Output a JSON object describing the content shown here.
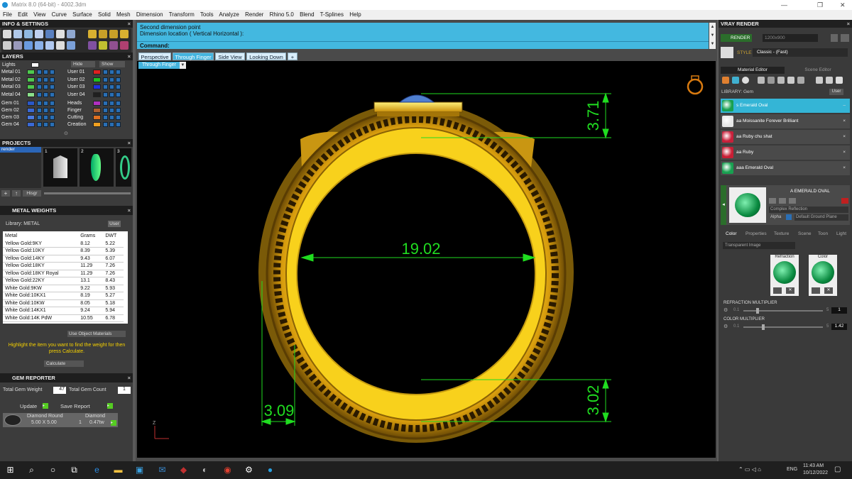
{
  "window": {
    "title": "Matrix 8.0 (64-bit) - 4002.3dm"
  },
  "menu": [
    "File",
    "Edit",
    "View",
    "Curve",
    "Surface",
    "Solid",
    "Mesh",
    "Dimension",
    "Transform",
    "Tools",
    "Analyze",
    "Render",
    "Rhino 5.0",
    "Blend",
    "T-Splines",
    "Help"
  ],
  "info_settings": {
    "title": "INFO & SETTINGS"
  },
  "layers": {
    "title": "LAYERS",
    "lights": "Lights",
    "hide": "Hide",
    "show": "Show",
    "left_items": [
      {
        "label": "Metal 01",
        "color": "#4ec94e"
      },
      {
        "label": "Metal 02",
        "color": "#4ec94e"
      },
      {
        "label": "Metal 03",
        "color": "#4ec94e"
      },
      {
        "label": "Metal 04",
        "color": "#8be08b"
      },
      {
        "label": "Gem 01",
        "color": "#2a58c8"
      },
      {
        "label": "Gem 02",
        "color": "#3a6ad6"
      },
      {
        "label": "Gem 03",
        "color": "#4a7ae0"
      },
      {
        "label": "Gem 04",
        "color": "#3a6ad6"
      }
    ],
    "right_items": [
      {
        "label": "User 01",
        "color": "#e02020"
      },
      {
        "label": "User 02",
        "color": "#20c020"
      },
      {
        "label": "User 03",
        "color": "#2030e0"
      },
      {
        "label": "User 04",
        "color": "#202020"
      },
      {
        "label": "Heads",
        "color": "#b030c0"
      },
      {
        "label": "Finger",
        "color": "#b06030"
      },
      {
        "label": "Cutting",
        "color": "#e07020"
      },
      {
        "label": "Creation",
        "color": "#f0a020"
      }
    ]
  },
  "projects": {
    "title": "PROJECTS",
    "item": "render",
    "thumbs": [
      "1",
      "2",
      "3"
    ],
    "hisgr": "Hisgr"
  },
  "metal_weights": {
    "title": "METAL WEIGHTS",
    "library_label": "Library: METAL",
    "user": "User",
    "columns": [
      "Metal",
      "Grams",
      "DWT"
    ],
    "rows": [
      [
        "Yellow Gold:9KY",
        "8.12",
        "5.22"
      ],
      [
        "Yellow Gold:10KY",
        "8.39",
        "5.39"
      ],
      [
        "Yellow Gold:14KY",
        "9.43",
        "6.07"
      ],
      [
        "Yellow Gold:18KY",
        "11.29",
        "7.26"
      ],
      [
        "Yellow Gold:18KY Royal",
        "11.29",
        "7.26"
      ],
      [
        "Yellow Gold:22KY",
        "13.1",
        "8.43"
      ],
      [
        "White Gold:9KW",
        "9.22",
        "5.93"
      ],
      [
        "White Gold:10KX1",
        "8.19",
        "5.27"
      ],
      [
        "White Gold:10KW",
        "8.05",
        "5.18"
      ],
      [
        "White Gold:14KX1",
        "9.24",
        "5.94"
      ],
      [
        "White Gold:14K PdW",
        "10.55",
        "6.78"
      ]
    ],
    "use_object_materials": "Use Object Materials",
    "hint": "Highlight the item you want to find the weight for then press Calculate.",
    "calculate": "Calculate"
  },
  "gem_reporter": {
    "title": "GEM REPORTER",
    "total_gem_weight_label": "Total Gem Weight",
    "total_gem_weight": "47",
    "total_gem_count_label": "Total Gem Count",
    "total_gem_count": "1",
    "update": "Update",
    "save_report": "Save Report",
    "gem_type": "Diamond Round",
    "gem_size": "5.00 X 5.00",
    "gem_material": "Diamond",
    "gem_qty": "1",
    "gem_weight": "0.47tw"
  },
  "command": {
    "line1": "Second dimension point",
    "line2": "Dimension location ( Vertical  Horizontal ):",
    "prompt": "Command:"
  },
  "viewport_tabs": [
    "Perspective",
    "Through Finger",
    "Side View",
    "Looking Down",
    "+"
  ],
  "active_view_label": "Through Finger",
  "dimensions": {
    "top": "3.71",
    "width": "19.02",
    "right_bottom": "3.02",
    "left_bottom": "3.09"
  },
  "vray": {
    "title": "VRAY RENDER",
    "render_btn": "RENDER",
    "resolution": "1200x900",
    "style_label": "STYLE",
    "style_value": "Classic - (Fast)",
    "tab_material": "Material Editor",
    "tab_scene": "Scene Editor",
    "library": "LIBRARY: Gem",
    "user": "User",
    "materials": [
      {
        "name": "s Emerald Oval",
        "color": "#18a050",
        "selected": true
      },
      {
        "name": "aa Moissanite Forever Brilliant",
        "color": "#e8e8e8",
        "selected": false
      },
      {
        "name": "aa Ruby chu shat",
        "color": "#c8203a",
        "selected": false
      },
      {
        "name": "aa Ruby",
        "color": "#c81e34",
        "selected": false
      },
      {
        "name": "aaa Emerald Oval",
        "color": "#18a050",
        "selected": false
      }
    ],
    "preview_name": "A EMERALD OVAL",
    "complex_reflection": "Complex Reflection",
    "alpha": "Alpha",
    "ground": "Default Ground Plane",
    "subtabs": [
      "Color",
      "Properties",
      "Texture",
      "Scene",
      "Toon",
      "Light"
    ],
    "transparent": "Transparent Image",
    "refraction": "Refraction",
    "color": "Color",
    "refraction_multiplier": "REFRACTION MULTIPLIER",
    "refr_min": "0.1",
    "refr_max": "5",
    "refr_value": "1",
    "color_multiplier": "COLOR MULTIPLIER",
    "col_min": "0.1",
    "col_max": "5",
    "col_value": "1.42"
  },
  "taskbar": {
    "time": "11:43 AM",
    "date": "10/12/2022",
    "lang": "ENG"
  }
}
